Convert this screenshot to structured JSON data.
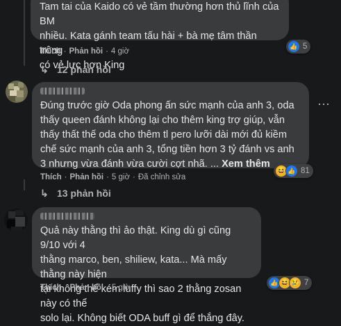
{
  "comments": [
    {
      "author": "",
      "text": "Tam tai của Kaido có vẻ tầm thường hơn thủ lĩnh của BM\nnhiều. Kata gánh team tấu hài + bà mẹ tâm thần trông\ncó vẻ lực hơn King",
      "like_label": "Thích",
      "reply_label": "Phản hồi",
      "time": "4 giờ",
      "reaction_count": "5",
      "reactions": [
        "like-icon"
      ],
      "replies_label": "12 phản hồi"
    },
    {
      "author": "",
      "text": "Đúng trước giờ Oda phong ấn sức mạnh của anh 3, oda\nthấy queen đánh không lại cho thêm king trợ giúp, vẫn\nthấy thất thế oda cho thêm tl pero lưỡi dài mới đủ kiềm\nchế sức mạnh của anh 3, tổng tiền hơn 3 tỷ đánh vs anh\n3 nhưng vừa đánh vừa cười cợt nhã. ...",
      "see_more": "Xem thêm",
      "like_label": "Thích",
      "reply_label": "Phản hồi",
      "time": "5 giờ",
      "edited": "Đã chỉnh sửa",
      "reaction_count": "81",
      "reactions": [
        "haha-icon",
        "like-icon"
      ],
      "replies_label": "13 phản hồi"
    },
    {
      "author": "",
      "text": "Quả này thằng thì ảo thật. King dù gì cũng 9/10 với 4\nthằng marco, ben, shiliew, kata... Mà mấy thằng này hiện\ntại không thể kém luffy thì sao 2 thằng zosan này có thể\nsolo lại. Không biết ODA buff gì để thắng đây.",
      "like_label": "Thích",
      "reply_label": "Phản hồi",
      "time": "5 giờ",
      "reaction_count": "7",
      "reactions": [
        "like-icon",
        "haha-icon",
        "sad-icon"
      ]
    }
  ],
  "icons": {
    "more": "⋯",
    "reply_arrow": "↳",
    "like": "👍",
    "haha": "😆",
    "sad": "😢"
  },
  "colors": {
    "background": "#18191a",
    "bubble": "#3a3b3c",
    "text": "#e4e6eb",
    "secondary": "#b0b3b8",
    "like_blue": "#1877f2"
  }
}
